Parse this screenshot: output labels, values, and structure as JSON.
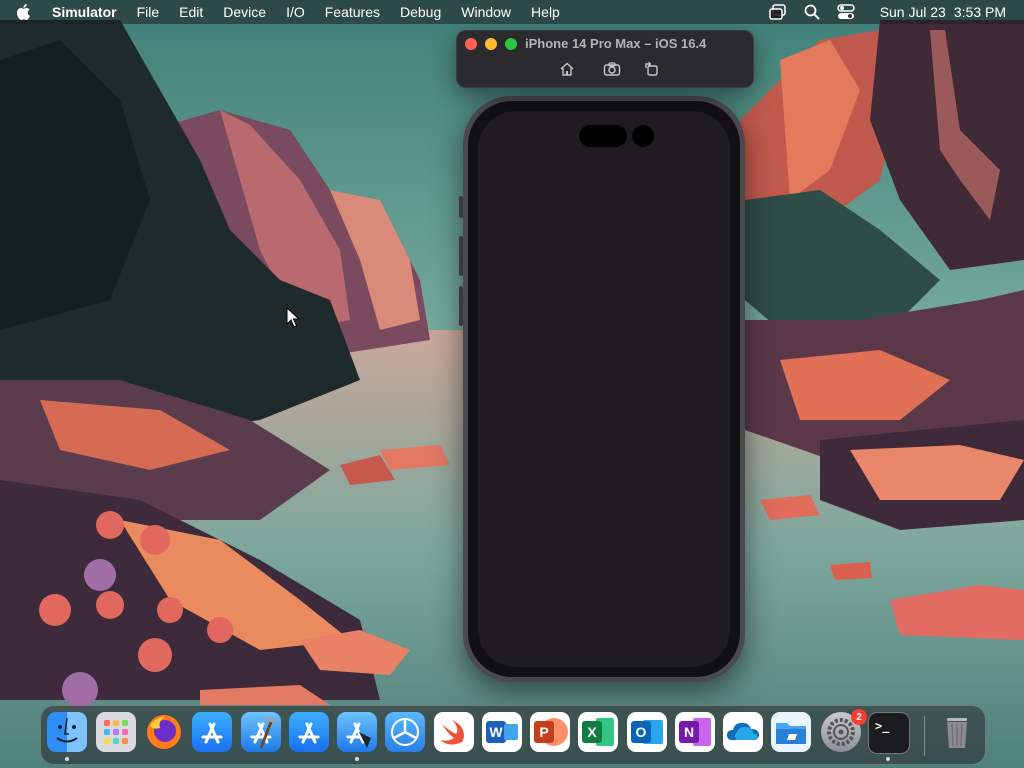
{
  "menubar": {
    "app_name": "Simulator",
    "items": [
      "File",
      "Edit",
      "Device",
      "I/O",
      "Features",
      "Debug",
      "Window",
      "Help"
    ],
    "date": "Sun Jul 23",
    "time": "3:53 PM"
  },
  "simulator": {
    "title": "iPhone 14 Pro Max – iOS 16.4",
    "tools": [
      "home-icon",
      "screenshot-icon",
      "rotate-icon"
    ]
  },
  "dock": {
    "apps": [
      {
        "name": "Finder",
        "icon": "finder-icon"
      },
      {
        "name": "Launchpad",
        "icon": "launchpad-icon"
      },
      {
        "name": "Firefox",
        "icon": "firefox-icon"
      },
      {
        "name": "App Store",
        "icon": "app-store-icon"
      },
      {
        "name": "Xcode",
        "icon": "xcode-icon"
      },
      {
        "name": "App Store",
        "icon": "app-store-icon"
      },
      {
        "name": "Xcode",
        "icon": "xcode-icon"
      },
      {
        "name": "Instruments",
        "icon": "instruments-icon"
      },
      {
        "name": "Swift Playgrounds",
        "icon": "swift-icon"
      },
      {
        "name": "Microsoft Word",
        "icon": "word-icon",
        "glyph": "W"
      },
      {
        "name": "Microsoft PowerPoint",
        "icon": "powerpoint-icon",
        "glyph": "P"
      },
      {
        "name": "Microsoft Excel",
        "icon": "excel-icon",
        "glyph": "X"
      },
      {
        "name": "Microsoft Outlook",
        "icon": "outlook-icon",
        "glyph": "O"
      },
      {
        "name": "Microsoft OneNote",
        "icon": "onenote-icon",
        "glyph": "N"
      },
      {
        "name": "OneDrive",
        "icon": "onedrive-icon"
      },
      {
        "name": "File Explorer",
        "icon": "file-explorer-icon"
      },
      {
        "name": "System Settings",
        "icon": "settings-icon",
        "badge": "2"
      },
      {
        "name": "Terminal",
        "icon": "terminal-icon",
        "glyph": ">_"
      },
      {
        "name": "Trash",
        "icon": "trash-icon"
      }
    ]
  },
  "colors": {
    "menubar_bg": "#1e1e20",
    "traffic_close": "#ff5f57",
    "traffic_min": "#febc2e",
    "traffic_max": "#28c840",
    "phone_screen": "#1f1c21",
    "badge": "#ff3b30"
  }
}
